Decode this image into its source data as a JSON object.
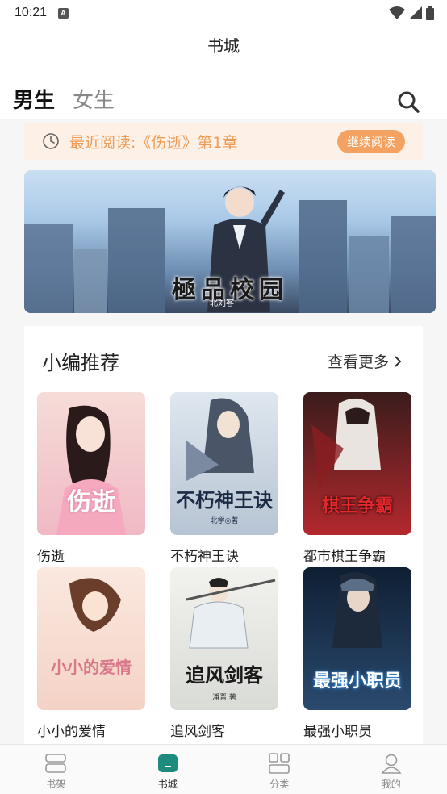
{
  "status_bar": {
    "time": "10:21",
    "notification_badge": "A"
  },
  "header": {
    "title": "书城"
  },
  "gender_tabs": [
    {
      "label": "男生",
      "active": true
    },
    {
      "label": "女生",
      "active": false
    }
  ],
  "recent": {
    "text": "最近阅读:《伤逝》第1章",
    "button_label": "继续阅读"
  },
  "banner": {
    "logo_text": "極品校园",
    "sub_text": "北刘客"
  },
  "recommend": {
    "title": "小编推荐",
    "more_label": "查看更多",
    "books": [
      {
        "title": "伤逝",
        "cover_text": "伤逝",
        "cover_colors": [
          "#f6dcd8",
          "#f0b9c4"
        ]
      },
      {
        "title": "不朽神王诀",
        "cover_text": "不朽神王诀",
        "cover_author": "北学◎著",
        "cover_colors": [
          "#dfe7ef",
          "#b7c4d3"
        ]
      },
      {
        "title": "都市棋王争霸",
        "cover_text": "棋王争霸",
        "cover_colors": [
          "#3a1c1c",
          "#b3282d"
        ]
      },
      {
        "title": "小小的爱情",
        "cover_text": "小小的爱情",
        "cover_colors": [
          "#fbe8df",
          "#f4d2c5"
        ]
      },
      {
        "title": "追风剑客",
        "cover_text": "追风剑客",
        "cover_author": "潘晋 著",
        "cover_colors": [
          "#f2f2ee",
          "#d9dbd6"
        ]
      },
      {
        "title": "最强小职员",
        "cover_text": "最强小职员",
        "cover_colors": [
          "#0f1f33",
          "#2a4a6e"
        ]
      }
    ]
  },
  "bottom_nav": [
    {
      "label": "书架",
      "icon": "bookshelf-icon",
      "active": false
    },
    {
      "label": "书城",
      "icon": "bookstore-icon",
      "active": true
    },
    {
      "label": "分类",
      "icon": "category-icon",
      "active": false
    },
    {
      "label": "我的",
      "icon": "profile-icon",
      "active": false
    }
  ],
  "colors": {
    "accent": "#1f8a7e",
    "orange": "#f4a261",
    "recent_bg": "#fdf1e7"
  }
}
